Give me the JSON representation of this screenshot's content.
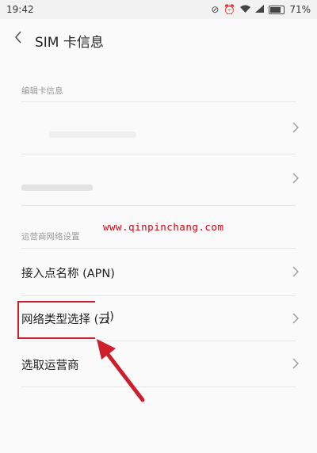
{
  "status_bar": {
    "time": "19:42",
    "battery_percent": "71%",
    "battery_level": 0.71,
    "icons": [
      "dnd-icon",
      "alarm-icon",
      "wifi-icon",
      "signal-icon",
      "battery-icon"
    ]
  },
  "header": {
    "title": "SIM 卡信息"
  },
  "sections": {
    "edit_card_info": "编辑卡信息",
    "carrier_network_settings": "运营商网络设置"
  },
  "rows": {
    "apn": "接入点名称 (APN)",
    "network_type": "网络类型选择 (云",
    "network_type_tail": "J)",
    "select_carrier": "选取运营商"
  },
  "watermark": "www.qinpinchang.com",
  "colors": {
    "background": "#fafafa",
    "divider": "#e6e6e6",
    "section_label": "#999999",
    "annotation_red": "#cc1f2b"
  }
}
